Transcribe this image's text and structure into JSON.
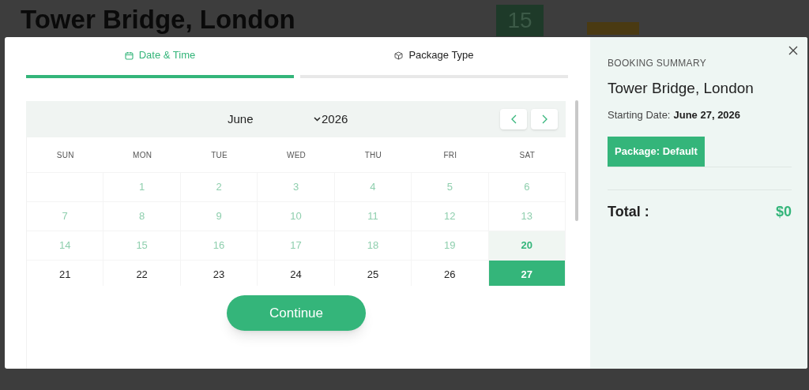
{
  "background": {
    "title": "Tower Bridge, London",
    "badge": "15"
  },
  "tabs": [
    {
      "label": "Date & Time",
      "selected": true
    },
    {
      "label": "Package Type",
      "selected": false
    }
  ],
  "calendar": {
    "month": "June",
    "year": "2026",
    "weekdays": [
      "SUN",
      "MON",
      "TUE",
      "WED",
      "THU",
      "FRI",
      "SAT"
    ],
    "weeks": [
      [
        {
          "kind": "blank"
        },
        {
          "kind": "past",
          "day": "1",
          "selected": false
        },
        {
          "kind": "past",
          "day": "2",
          "selected": false
        },
        {
          "kind": "past",
          "day": "3",
          "selected": false
        },
        {
          "kind": "past",
          "day": "4",
          "selected": false
        },
        {
          "kind": "past",
          "day": "5",
          "selected": false
        },
        {
          "kind": "past",
          "day": "6",
          "selected": false
        }
      ],
      [
        {
          "kind": "past",
          "day": "7",
          "selected": false
        },
        {
          "kind": "past",
          "day": "8",
          "selected": false
        },
        {
          "kind": "past",
          "day": "9",
          "selected": false
        },
        {
          "kind": "past",
          "day": "10",
          "selected": false
        },
        {
          "kind": "past",
          "day": "11",
          "selected": false
        },
        {
          "kind": "past",
          "day": "12",
          "selected": false
        },
        {
          "kind": "past",
          "day": "13",
          "selected": false
        }
      ],
      [
        {
          "kind": "past",
          "day": "14",
          "selected": false
        },
        {
          "kind": "past",
          "day": "15",
          "selected": false
        },
        {
          "kind": "past",
          "day": "16",
          "selected": false
        },
        {
          "kind": "past",
          "day": "17",
          "selected": false
        },
        {
          "kind": "past",
          "day": "18",
          "selected": false
        },
        {
          "kind": "past",
          "day": "19",
          "selected": false
        },
        {
          "kind": "today",
          "day": "20",
          "selected": false
        }
      ],
      [
        {
          "kind": "open",
          "day": "21",
          "selected": false
        },
        {
          "kind": "open",
          "day": "22",
          "selected": false
        },
        {
          "kind": "open",
          "day": "23",
          "selected": false
        },
        {
          "kind": "open",
          "day": "24",
          "selected": false
        },
        {
          "kind": "open",
          "day": "25",
          "selected": false
        },
        {
          "kind": "open",
          "day": "26",
          "selected": false
        },
        {
          "kind": "open",
          "day": "27",
          "selected": true
        }
      ]
    ]
  },
  "continue_button": "Continue",
  "summary": {
    "heading": "BOOKING SUMMARY",
    "title": "Tower Bridge, London",
    "date_label": "Starting Date:",
    "date_value": "June 27, 2026",
    "package": "Package: Default",
    "total_label": "Total :",
    "total_value": "$0"
  }
}
